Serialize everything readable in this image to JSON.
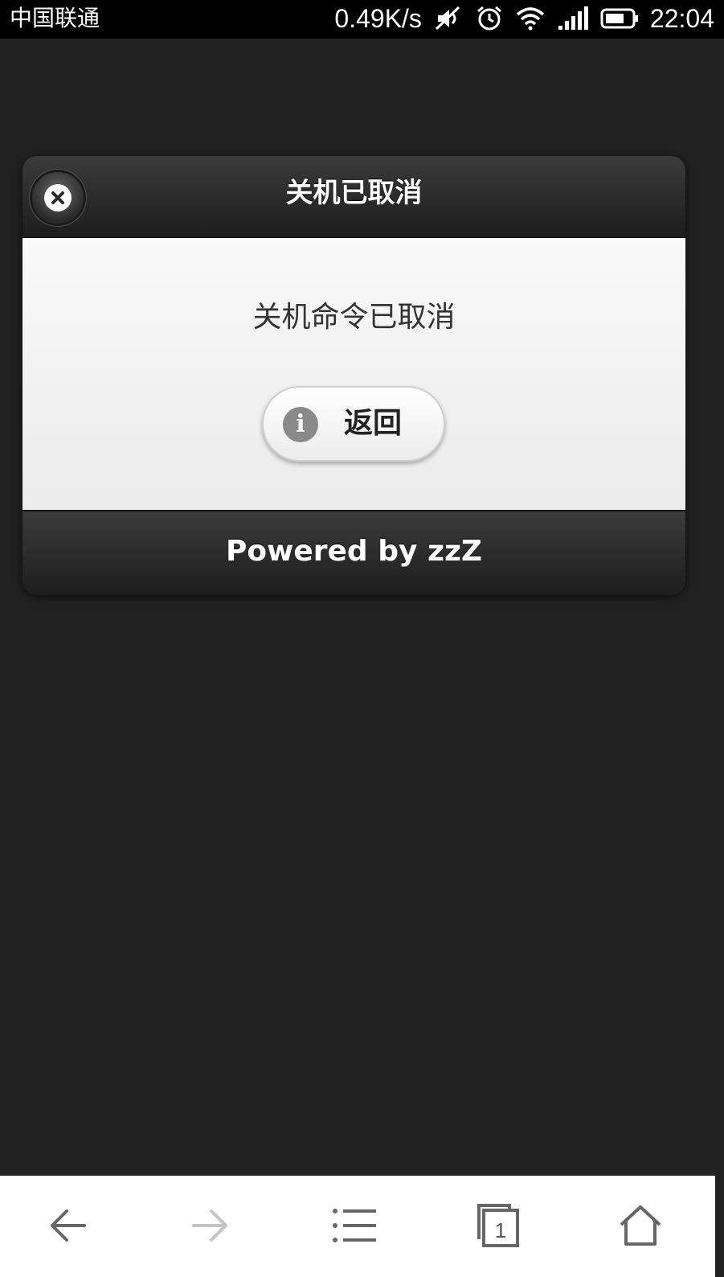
{
  "status_bar": {
    "carrier": "中国联通",
    "net_speed": "0.49K/s",
    "time": "22:04",
    "icons": [
      "mute-icon",
      "alarm-icon",
      "wifi-icon",
      "signal-icon",
      "battery-icon"
    ]
  },
  "dialog": {
    "title": "关机已取消",
    "message": "关机命令已取消",
    "back_button_label": "返回",
    "info_icon_glyph": "i",
    "footer": "Powered by zzZ"
  },
  "browser_bar": {
    "tab_count": "1",
    "buttons": [
      "back-arrow-icon",
      "forward-arrow-icon",
      "menu-icon",
      "tabs-icon",
      "home-icon"
    ]
  },
  "colors": {
    "page_background": "#222222",
    "dialog_body": "#f3f3f3",
    "header_footer": "#2a2a2a"
  }
}
